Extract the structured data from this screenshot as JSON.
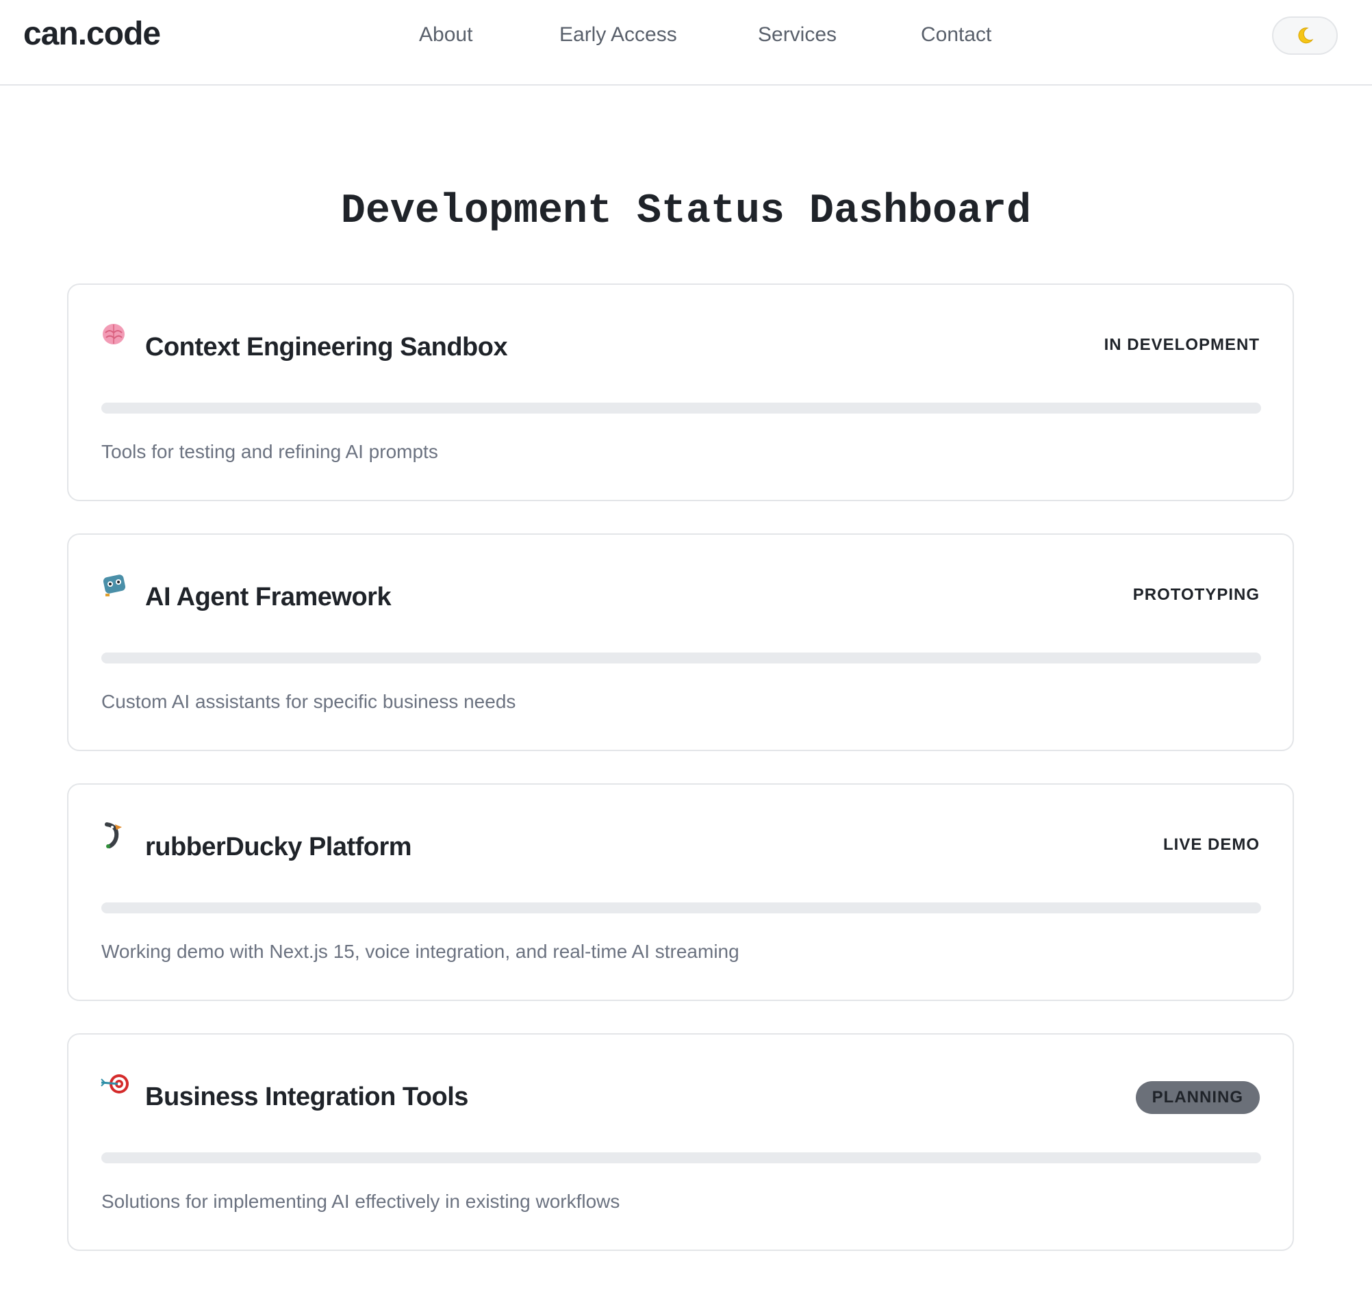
{
  "header": {
    "logo": "can.code",
    "nav": [
      {
        "label": "About"
      },
      {
        "label": "Early Access"
      },
      {
        "label": "Services"
      },
      {
        "label": "Contact"
      }
    ],
    "theme_toggle_icon": "moon-icon"
  },
  "main": {
    "title": "Development Status Dashboard",
    "cards": [
      {
        "icon": "brain-icon",
        "title": "Context Engineering Sandbox",
        "status": "IN DEVELOPMENT",
        "progress": 0,
        "description": "Tools for testing and refining AI prompts"
      },
      {
        "icon": "robot-icon",
        "title": "AI Agent Framework",
        "status": "PROTOTYPING",
        "progress": 0,
        "description": "Custom AI assistants for specific business needs"
      },
      {
        "icon": "duck-icon",
        "title": "rubberDucky Platform",
        "status": "LIVE DEMO",
        "progress": 0,
        "description": "Working demo with Next.js 15, voice integration, and real-time AI streaming"
      },
      {
        "icon": "target-icon",
        "title": "Business Integration Tools",
        "status": "PLANNING",
        "progress": 0,
        "description": "Solutions for implementing AI effectively in existing workflows"
      }
    ]
  },
  "colors": {
    "text": "#1f2329",
    "muted": "#6b7280",
    "nav": "#59606b",
    "border": "#e3e5e8",
    "track": "#e8eaed",
    "planning_badge": "#6b7079"
  }
}
